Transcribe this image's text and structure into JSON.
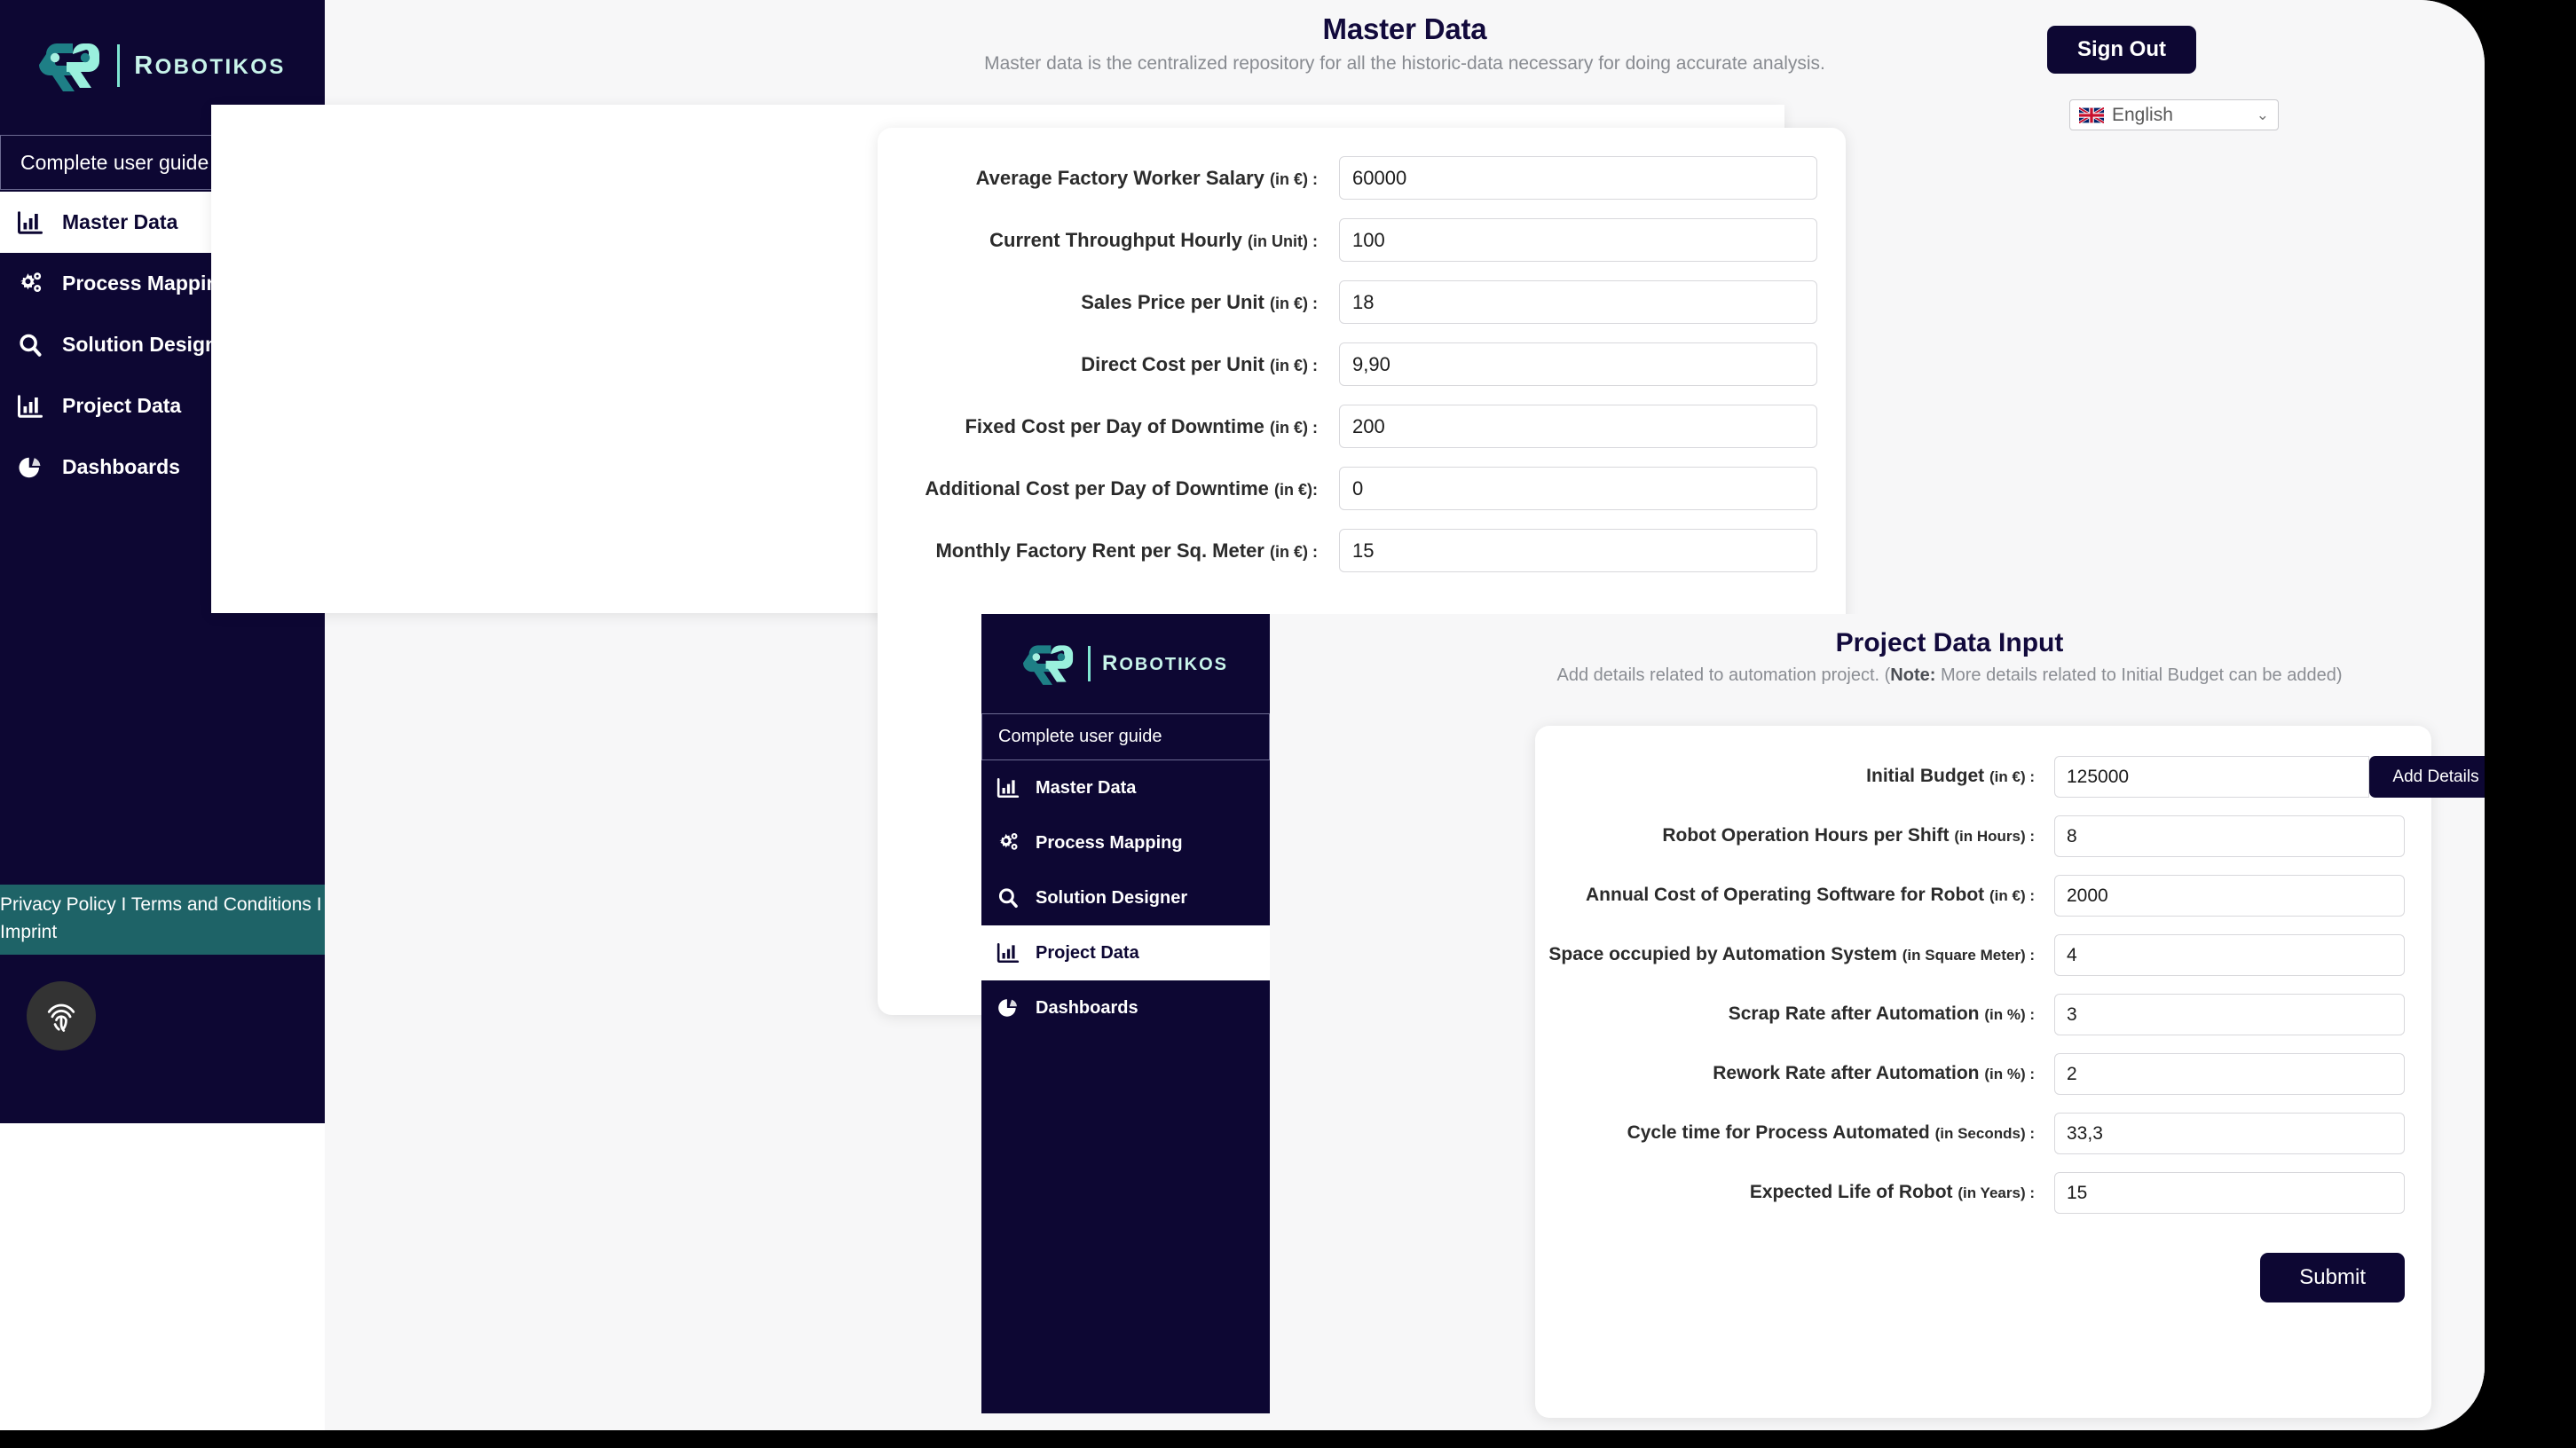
{
  "brand": {
    "name_cap": "R",
    "name_rest": "OBOTIKOS"
  },
  "sidebar": {
    "guide_label": "Complete user guide",
    "items": [
      {
        "label": "Master Data",
        "icon": "bar-chart-icon",
        "active": true
      },
      {
        "label": "Process Mapping",
        "icon": "gears-icon",
        "active": false
      },
      {
        "label": "Solution Designer",
        "icon": "search-icon",
        "active": false
      },
      {
        "label": "Project Data",
        "icon": "bar-chart-icon",
        "active": false
      },
      {
        "label": "Dashboards",
        "icon": "pie-chart-icon",
        "active": false
      }
    ],
    "legal": "Privacy Policy I Terms and Conditions I Imprint",
    "fingerprint_icon": "fingerprint-icon"
  },
  "header": {
    "title": "Master Data",
    "subtitle": "Master data is the centralized repository for all the historic-data necessary for doing accurate analysis.",
    "sign_out_label": "Sign Out",
    "language_value": "English",
    "language_flag": "uk-flag-icon",
    "chevron_icon": "chevron-down-icon"
  },
  "master_data": {
    "fields": [
      {
        "label": "Average Factory Worker Salary",
        "unit": "(in €) :",
        "value": "60000"
      },
      {
        "label": "Current Throughput Hourly",
        "unit": "(in Unit) :",
        "value": "100"
      },
      {
        "label": "Sales Price per Unit",
        "unit": "(in €) :",
        "value": "18"
      },
      {
        "label": "Direct Cost per Unit",
        "unit": "(in €) :",
        "value": "9,90"
      },
      {
        "label": "Fixed Cost per Day of Downtime",
        "unit": "(in €) :",
        "value": "200"
      },
      {
        "label": "Additional Cost per Day of Downtime",
        "unit": "(in €):",
        "value": "0"
      },
      {
        "label": "Monthly Factory Rent per Sq. Meter",
        "unit": "(in €) :",
        "value": "15"
      }
    ]
  },
  "project_data": {
    "title": "Project Data Input",
    "subtitle_before": "Add details related to automation project. (",
    "subtitle_note": "Note:",
    "subtitle_after": " More details related to Initial Budget can be added)",
    "sidebar": {
      "guide_label": "Complete user guide",
      "items": [
        {
          "label": "Master Data",
          "icon": "bar-chart-icon",
          "active": false
        },
        {
          "label": "Process Mapping",
          "icon": "gears-icon",
          "active": false
        },
        {
          "label": "Solution Designer",
          "icon": "search-icon",
          "active": false
        },
        {
          "label": "Project Data",
          "icon": "bar-chart-icon",
          "active": true
        },
        {
          "label": "Dashboards",
          "icon": "pie-chart-icon",
          "active": false
        }
      ]
    },
    "add_details_label": "Add Details",
    "submit_label": "Submit",
    "fields": [
      {
        "label": "Initial Budget",
        "unit": "(in €) :",
        "value": "125000",
        "has_button": true
      },
      {
        "label": "Robot Operation Hours per Shift",
        "unit": "(in Hours) :",
        "value": "8",
        "has_button": false
      },
      {
        "label": "Annual Cost of Operating Software for Robot",
        "unit": "(in €) :",
        "value": "2000",
        "has_button": false
      },
      {
        "label": "Space occupied by Automation System",
        "unit": "(in Square Meter) :",
        "value": "4",
        "has_button": false
      },
      {
        "label": "Scrap Rate after Automation",
        "unit": "(in %) :",
        "value": "3",
        "has_button": false
      },
      {
        "label": "Rework Rate after Automation",
        "unit": "(in %) :",
        "value": "2",
        "has_button": false
      },
      {
        "label": "Cycle time for Process Automated",
        "unit": "(in Seconds) :",
        "value": "33,3",
        "has_button": false
      },
      {
        "label": "Expected Life of Robot",
        "unit": "(in Years) :",
        "value": "15",
        "has_button": false
      }
    ]
  },
  "colors": {
    "brand_dark": "#0d0733",
    "brand_mint": "#7fe6d2",
    "brand_teal": "#1e6367",
    "surface": "#f7f7f8"
  }
}
